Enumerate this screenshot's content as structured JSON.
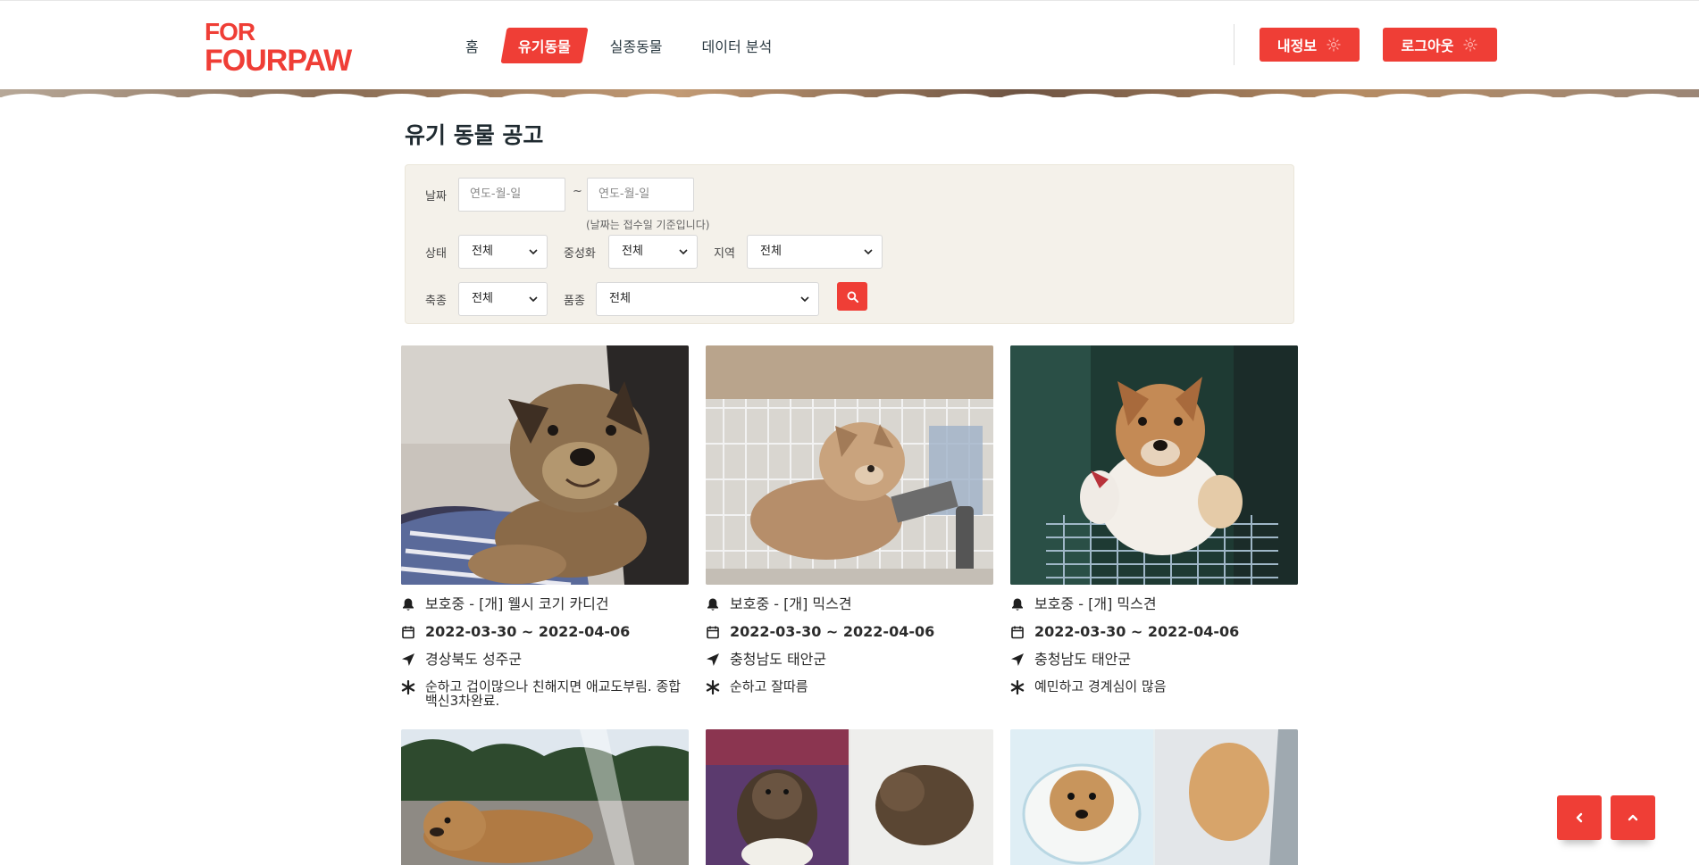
{
  "brand": {
    "line1": "FOR",
    "line2": "FOURPAW",
    "color": "#ef3e36"
  },
  "nav": {
    "items": [
      {
        "label": "홈",
        "active": false
      },
      {
        "label": "유기동물",
        "active": true
      },
      {
        "label": "실종동물",
        "active": false
      },
      {
        "label": "데이터 분석",
        "active": false
      }
    ]
  },
  "header_buttons": {
    "myinfo": "내정보",
    "logout": "로그아웃"
  },
  "page": {
    "title": "유기 동물 공고"
  },
  "filters": {
    "date_label": "날짜",
    "date_from_placeholder": "연도-월-일",
    "date_to_placeholder": "연도-월-일",
    "tilde": "~",
    "date_note": "(날짜는 접수일 기준입니다)",
    "status_label": "상태",
    "status_value": "전체",
    "neuter_label": "중성화",
    "neuter_value": "전체",
    "region_label": "지역",
    "region_value": "전체",
    "species_label": "축종",
    "species_value": "전체",
    "breed_label": "품종",
    "breed_value": "전체"
  },
  "cards": [
    {
      "status": "보호중 - [개] 웰시 코기 카디건",
      "period": "2022-03-30 ~ 2022-04-06",
      "location": "경상북도 성주군",
      "note": "순하고 겁이많으나 친해지면 애교도부림. 종합백신3차완료."
    },
    {
      "status": "보호중 - [개] 믹스견",
      "period": "2022-03-30 ~ 2022-04-06",
      "location": "충청남도 태안군",
      "note": "순하고 잘따름"
    },
    {
      "status": "보호중 - [개] 믹스견",
      "period": "2022-03-30 ~ 2022-04-06",
      "location": "충청남도 태안군",
      "note": "예민하고 경계심이 많음"
    }
  ],
  "colors": {
    "accent": "#ef3e36",
    "filter_bg": "#f4f1ea",
    "text_dark": "#1f2a30"
  },
  "icons": [
    "bell-icon",
    "calendar-icon",
    "location-arrow-icon",
    "asterisk-icon",
    "search-icon",
    "settings-icon",
    "chevron-left-icon",
    "chevron-up-icon"
  ]
}
